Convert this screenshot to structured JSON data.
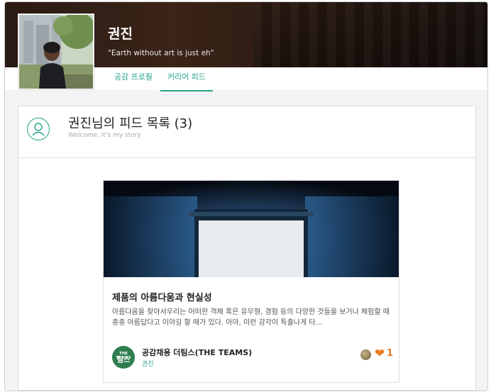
{
  "profile": {
    "name": "권진",
    "motto": "\"Earth without art is just eh\""
  },
  "tabs": [
    {
      "label": "공감 프로필",
      "active": false
    },
    {
      "label": "커리어 피드",
      "active": true
    }
  ],
  "feed": {
    "title": "권진님의 피드 목록 (3)",
    "subtitle": "Welcome, it's my story"
  },
  "card": {
    "title": "제품의 아름다움과 현실성",
    "excerpt": "아름다움을 찾아서우리는 어떠한 객체 혹은 유무형, 경험 등의 다양한 것들을 보거나 체험할 때 종종 아름답다고 이야길 할 때가 있다. 아마, 이런 감각이 특출나게 타...",
    "company": "공감채용 더팀스(THE TEAMS)",
    "author": "권진",
    "like_count": "1",
    "logo_text_top": "THE TEAMS",
    "logo_text_bottom": "팀스"
  },
  "colors": {
    "accent": "#25a58a",
    "like": "#e87a22",
    "banner": "#2a1a14"
  },
  "icons": [
    "user-circle-icon",
    "heart-icon"
  ]
}
